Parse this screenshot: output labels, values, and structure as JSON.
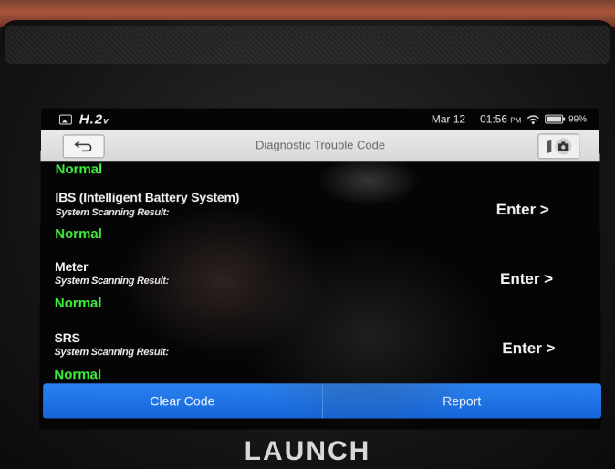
{
  "status_bar": {
    "voltage": "H.2",
    "voltage_unit": "v",
    "date": "Mar 12",
    "time": "01:56",
    "meridiem": "PM",
    "battery": "99%"
  },
  "header": {
    "title": "Diagnostic Trouble Code"
  },
  "results": {
    "top_partial_status": "Normal",
    "items": [
      {
        "name": "IBS (Intelligent Battery System)",
        "scan_label": "System Scanning Result:",
        "status": "Normal",
        "action": "Enter >"
      },
      {
        "name": "Meter",
        "scan_label": "System Scanning Result:",
        "status": "Normal",
        "action": "Enter >"
      },
      {
        "name": "SRS",
        "scan_label": "System Scanning Result:",
        "status": "Normal",
        "action": "Enter >"
      }
    ]
  },
  "footer": {
    "clear_code": "Clear Code",
    "report": "Report"
  },
  "device": {
    "brand": "LAUNCH"
  },
  "colors": {
    "status_normal": "#3ef03e",
    "action_bar": "#1f78e8",
    "title_bar": "#e0e0e0"
  }
}
